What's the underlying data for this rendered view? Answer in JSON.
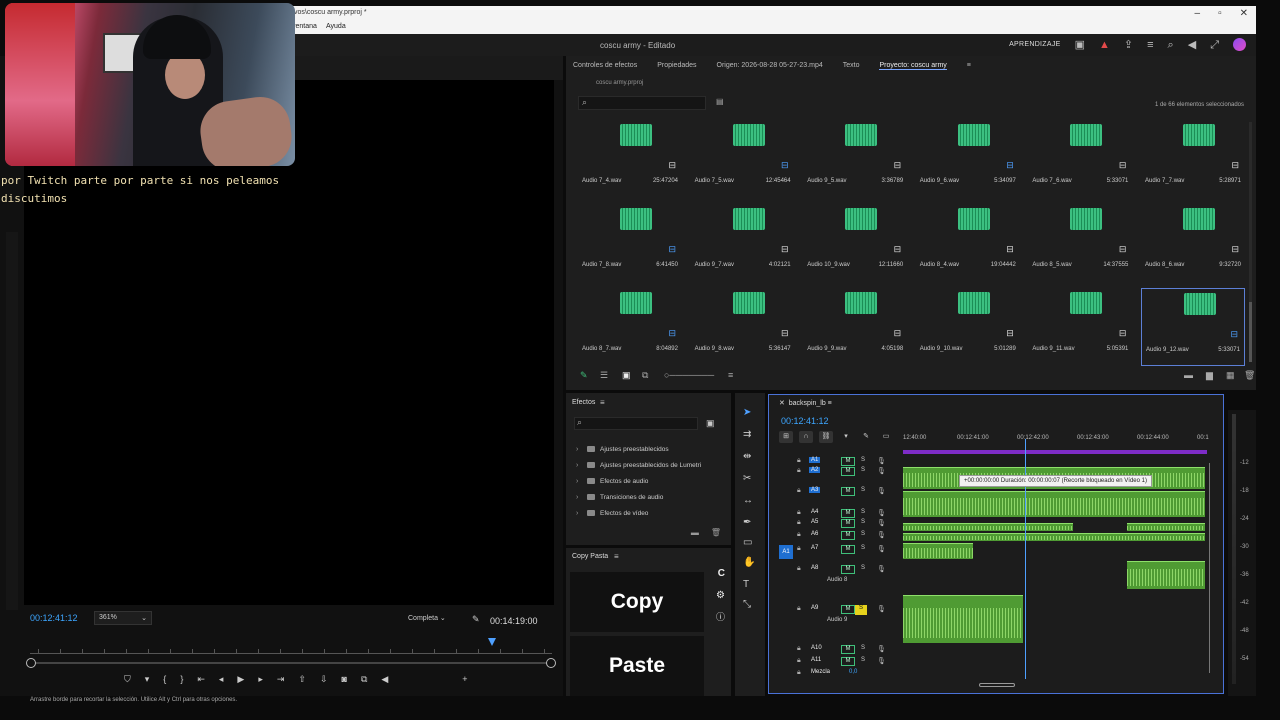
{
  "window": {
    "path_title": "vos\\coscu army.prproj *",
    "menus": [
      "ventana",
      "Ayuda"
    ]
  },
  "header": {
    "title": "coscu army - Editado",
    "learn_label": "APRENDIZAJE"
  },
  "webcam_caption": {
    "line1": "por Twitch parte por parte si nos peleamos",
    "line2": "discutimos"
  },
  "program_monitor": {
    "timecode": "00:12:41:12",
    "zoom": "361%",
    "resolution": "Completa",
    "duration": "00:14:19:00"
  },
  "project_panel": {
    "tabs": [
      "Controles de efectos",
      "Propiedades",
      "Origen: 2026-08-28 05-27-23.mp4",
      "Texto",
      "Proyecto: coscu army"
    ],
    "active_tab": "Proyecto: coscu army",
    "file": "coscu army.prproj",
    "selection_count": "1 de 66 elementos seleccionados",
    "items": [
      {
        "name": "Audio 7_4.wav",
        "duration": "25:47204",
        "badge": "link"
      },
      {
        "name": "Audio 7_5.wav",
        "duration": "12:45464",
        "badge": "blue"
      },
      {
        "name": "Audio 9_5.wav",
        "duration": "3:36789",
        "badge": "link"
      },
      {
        "name": "Audio 9_6.wav",
        "duration": "5:34097",
        "badge": "blue"
      },
      {
        "name": "Audio 7_6.wav",
        "duration": "5:33071",
        "badge": "link"
      },
      {
        "name": "Audio 7_7.wav",
        "duration": "5:28971",
        "badge": "link"
      },
      {
        "name": "Audio 7_8.wav",
        "duration": "6:41450",
        "badge": "blue"
      },
      {
        "name": "Audio 9_7.wav",
        "duration": "4:02121",
        "badge": "link"
      },
      {
        "name": "Audio 10_9.wav",
        "duration": "12:11660",
        "badge": "link"
      },
      {
        "name": "Audio 8_4.wav",
        "duration": "19:04442",
        "badge": "link"
      },
      {
        "name": "Audio 8_5.wav",
        "duration": "14:37555",
        "badge": "link"
      },
      {
        "name": "Audio 8_6.wav",
        "duration": "9:32720",
        "badge": "link"
      },
      {
        "name": "Audio 8_7.wav",
        "duration": "8:04892",
        "badge": "blue"
      },
      {
        "name": "Audio 9_8.wav",
        "duration": "5:36147",
        "badge": "link"
      },
      {
        "name": "Audio 9_9.wav",
        "duration": "4:05198",
        "badge": "link"
      },
      {
        "name": "Audio 9_10.wav",
        "duration": "5:01289",
        "badge": "link"
      },
      {
        "name": "Audio 9_11.wav",
        "duration": "5:05391",
        "badge": "link"
      },
      {
        "name": "Audio 9_12.wav",
        "duration": "5:33071",
        "badge": "blue",
        "selected": true
      }
    ]
  },
  "effects_panel": {
    "title": "Efectos",
    "items": [
      "Ajustes preestablecidos",
      "Ajustes preestablecidos de Lumetri",
      "Efectos de audio",
      "Transiciones de audio",
      "Efectos de vídeo"
    ]
  },
  "copy_paste": {
    "title": "Copy Pasta",
    "copy": "Copy",
    "paste": "Paste",
    "side_letter": "C"
  },
  "timeline": {
    "sequence": "backspin_lb",
    "timecode": "00:12:41:12",
    "ruler": [
      "12:40:00",
      "00:12:41:00",
      "00:12:42:00",
      "00:12:43:00",
      "00:12:44:00",
      "00:1"
    ],
    "tooltip": "+00:00:00:00 Duración: 00:00:00:07 (Recorte bloqueado en Vídeo 1)",
    "tracks": [
      {
        "name": "A1",
        "highlight": true
      },
      {
        "name": "A2",
        "highlight": true
      },
      {
        "name": "A3",
        "highlight": true
      },
      {
        "name": "A4"
      },
      {
        "name": "A5"
      },
      {
        "name": "A6"
      },
      {
        "name": "A7"
      },
      {
        "name": "A8",
        "sub": "Audio 8"
      },
      {
        "name": "A9",
        "sub": "Audio 9"
      },
      {
        "name": "A10"
      },
      {
        "name": "A11"
      }
    ],
    "mix_label": "Mezcla",
    "mix_value": "0,0",
    "source_patch": "A1",
    "mute": "M",
    "solo": "S"
  },
  "meters": [
    "-12",
    "-18",
    "-24",
    "-30",
    "-36",
    "-42",
    "-48",
    "-54"
  ],
  "status_text": "Arrastre borde para recortar la selección. Utilice Alt y Ctrl para otras opciones.",
  "icons": [
    "minimize-icon",
    "maximize-icon",
    "close-icon",
    "alert-icon",
    "search-icon",
    "folder-icon",
    "play-icon",
    "wrench-icon"
  ]
}
